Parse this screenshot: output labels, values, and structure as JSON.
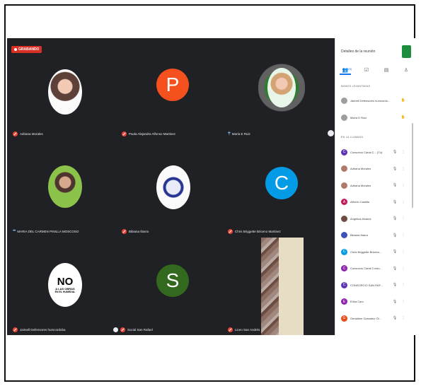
{
  "recording_label": "GRABANDO",
  "panel": {
    "title": "Detalles de la reunión",
    "people_tab": "(23)",
    "section_raised": "MANOS LEVANTADAS",
    "section_call": "EN LA LLAMADA",
    "raised": [
      {
        "name": "Jaimell Defensores humcordo..."
      },
      {
        "name": "María E Ruiz"
      }
    ],
    "participants": [
      {
        "name": "Consorcio Canal C... (Tú)",
        "initial": "C",
        "color": "#5e35b1"
      },
      {
        "name": "Adriana Morales",
        "initial": "",
        "color": "#b07a6a"
      },
      {
        "name": "Adriana Morales",
        "initial": "",
        "color": "#b07a6a"
      },
      {
        "name": "Alfredo Castilla",
        "initial": "A",
        "color": "#c2185b"
      },
      {
        "name": "Angelica Alvarez",
        "initial": "",
        "color": "#6d4c41"
      },
      {
        "name": "Bibiana Ibarra",
        "initial": "",
        "color": "#3f51b5"
      },
      {
        "name": "Chris Briggette Briceno...",
        "initial": "C",
        "color": "#039be5"
      },
      {
        "name": "Consorcio Canal Cordo...",
        "initial": "C",
        "color": "#8e24aa"
      },
      {
        "name": "CONSORCIO SAN RAF...",
        "initial": "C",
        "color": "#5e35b1"
      },
      {
        "name": "Erika Caro",
        "initial": "E",
        "color": "#8e24aa"
      },
      {
        "name": "Geraldine Gonzalez Ol...",
        "initial": "G",
        "color": "#e64a19"
      }
    ]
  },
  "tiles": [
    {
      "name": "Adriana Morales"
    },
    {
      "name": "Paola Alejandra Alfonso Martinez",
      "initial": "P",
      "color": "#f4511e"
    },
    {
      "name": "María E Ruiz"
    },
    {
      "name": "MARIA DEL CARMEN PINILLA MOSCOSO"
    },
    {
      "name": "Bibiana Ibarra"
    },
    {
      "name": "Chris Briggette Briceno Martinez",
      "initial": "C",
      "color": "#039be5"
    },
    {
      "name": "Jaimell Defensores humcordoba",
      "poster": [
        "NO",
        "A LAS OBRAS",
        "EN EL HUMEDAL"
      ]
    },
    {
      "name": "Social San Rafael",
      "initial": "S",
      "color": "#33691e"
    },
    {
      "name": "Liceo San Andrés"
    }
  ]
}
